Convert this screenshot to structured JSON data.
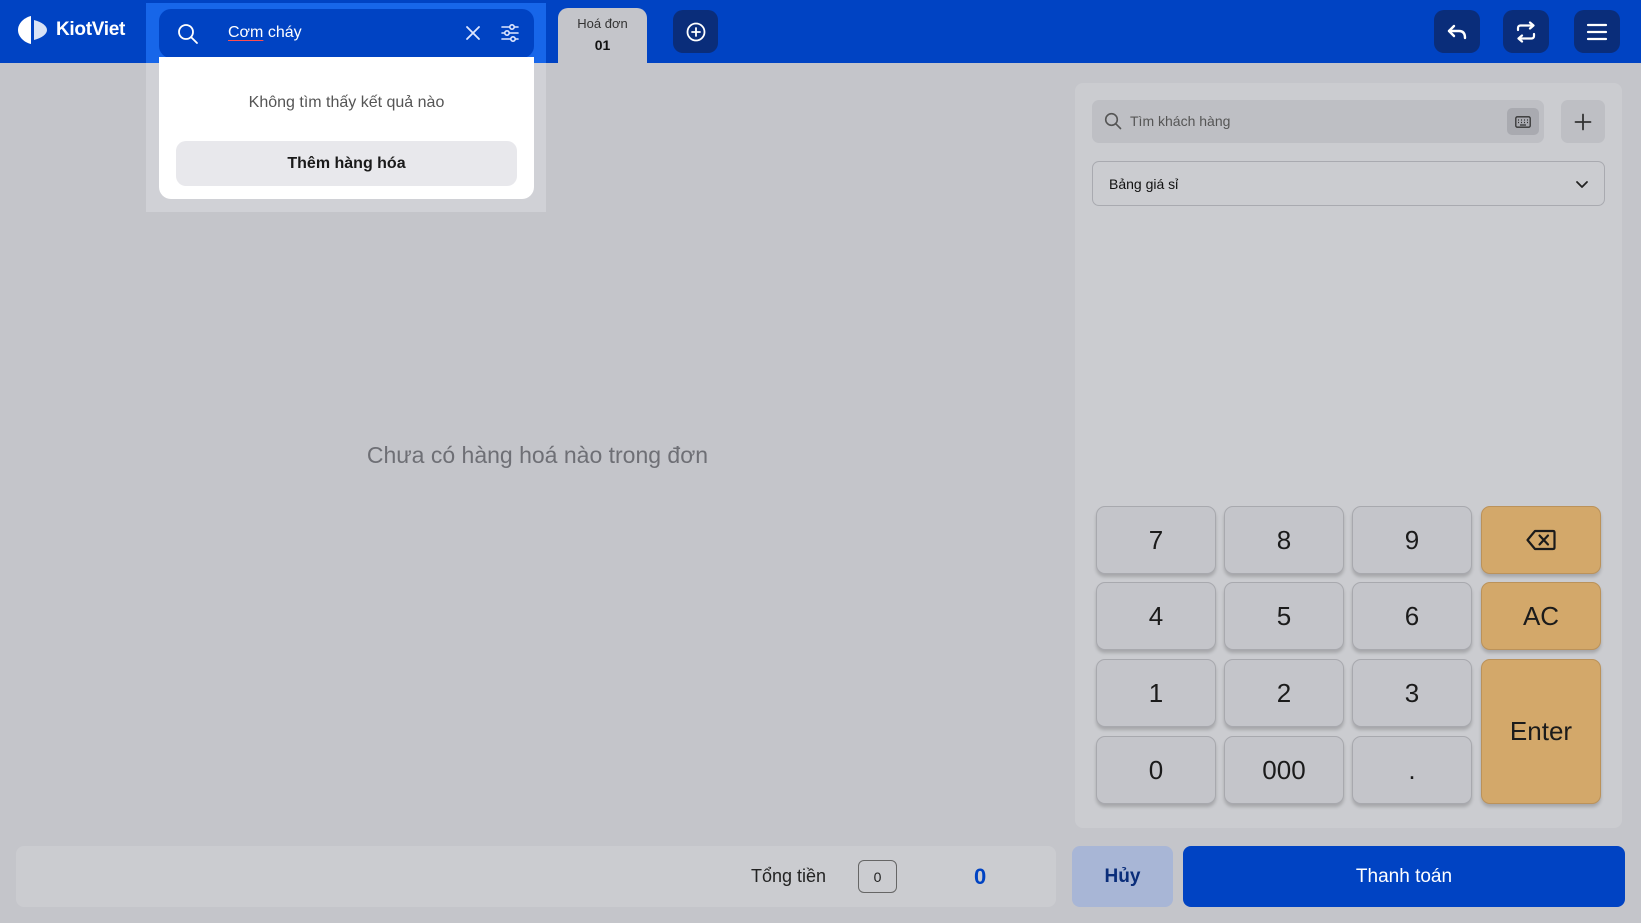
{
  "app": {
    "brand": "KiotViet"
  },
  "search": {
    "value": "Cơm cháy",
    "value_underlined": "Cơm",
    "value_rest": " cháy",
    "no_result_text": "Không tìm thấy kết quả nào",
    "add_goods_label": "Thêm hàng hóa"
  },
  "tabs": [
    {
      "title": "Hoá đơn",
      "number": "01"
    }
  ],
  "main": {
    "empty_message": "Chưa có hàng hoá nào trong đơn"
  },
  "customer": {
    "search_placeholder": "Tìm khách hàng",
    "price_list": "Bảng giá sỉ"
  },
  "keypad": {
    "k7": "7",
    "k8": "8",
    "k9": "9",
    "k4": "4",
    "k5": "5",
    "k6": "6",
    "ac": "AC",
    "k1": "1",
    "k2": "2",
    "k3": "3",
    "enter": "Enter",
    "k0": "0",
    "k000": "000",
    "dot": "."
  },
  "footer": {
    "total_label": "Tổng tiền",
    "item_count": "0",
    "total_value": "0",
    "cancel_label": "Hủy",
    "pay_label": "Thanh toán"
  },
  "colors": {
    "primary": "#0043c3",
    "dark_button": "#0a2d7a",
    "accent_key": "#d3a86a",
    "background": "#c4c5ca"
  },
  "icons": [
    "logo-icon",
    "search-icon",
    "clear-icon",
    "filter-icon",
    "add-circle-icon",
    "undo-icon",
    "sync-icon",
    "menu-icon",
    "keyboard-icon",
    "plus-icon",
    "chevron-down-icon",
    "backspace-icon"
  ]
}
